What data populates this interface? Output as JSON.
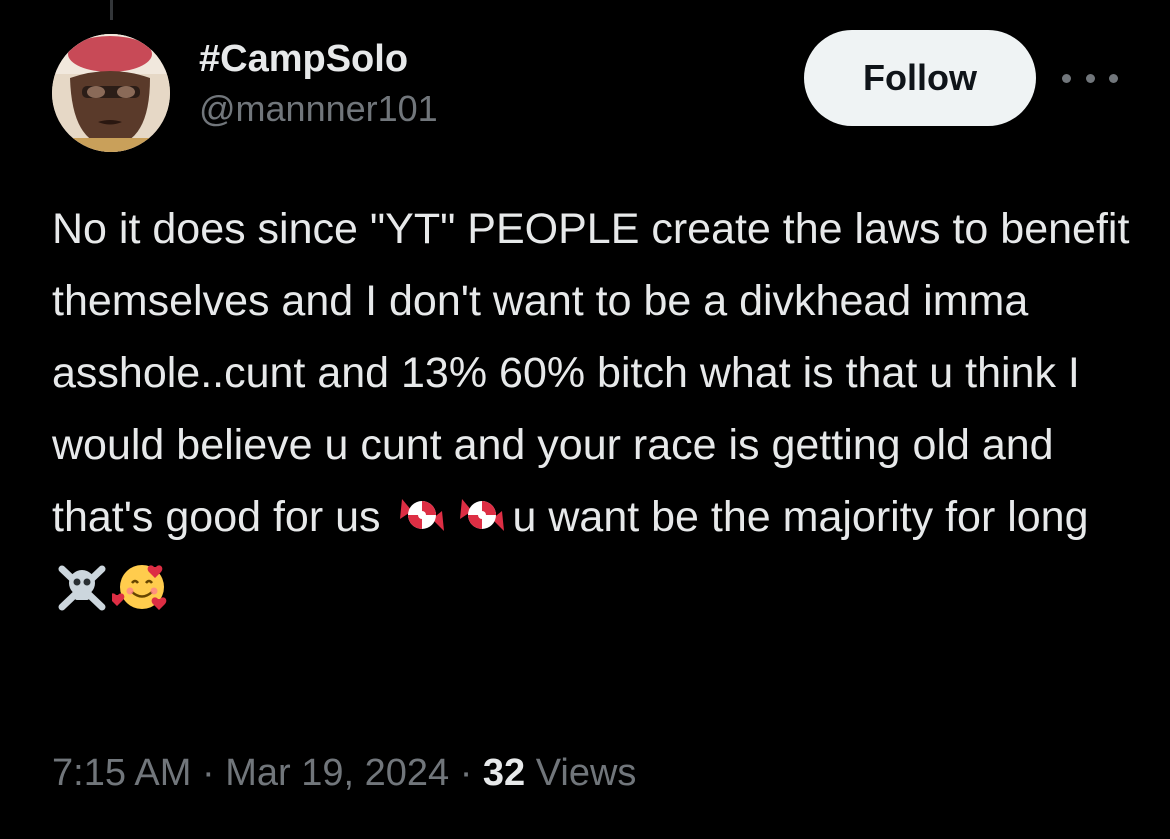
{
  "user": {
    "display_name": "#CampSolo",
    "handle": "@mannner101",
    "avatar_icon": "user-avatar-photo"
  },
  "actions": {
    "follow_label": "Follow",
    "more_icon": "more-horizontal-icon"
  },
  "tweet": {
    "text_before_candy": "No it does since \"YT\" PEOPLE create the laws to benefit themselves and I don't want to be a divkhead imma asshole..cunt and 13% 60% bitch what is that u think I would believe u cunt and your race is getting old and that's good for us ",
    "text_after_candy": "u want be the majority for long",
    "emojis": [
      "candy",
      "candy",
      "skull-and-crossbones",
      "smiling-face-with-hearts"
    ]
  },
  "meta": {
    "time": "7:15 AM",
    "separator": "·",
    "date": "Mar 19, 2024",
    "views_count": "32",
    "views_label": "Views"
  },
  "colors": {
    "background": "#000000",
    "primary_text": "#e7e9ea",
    "secondary_text": "#71767b",
    "follow_bg": "#eff3f4"
  }
}
